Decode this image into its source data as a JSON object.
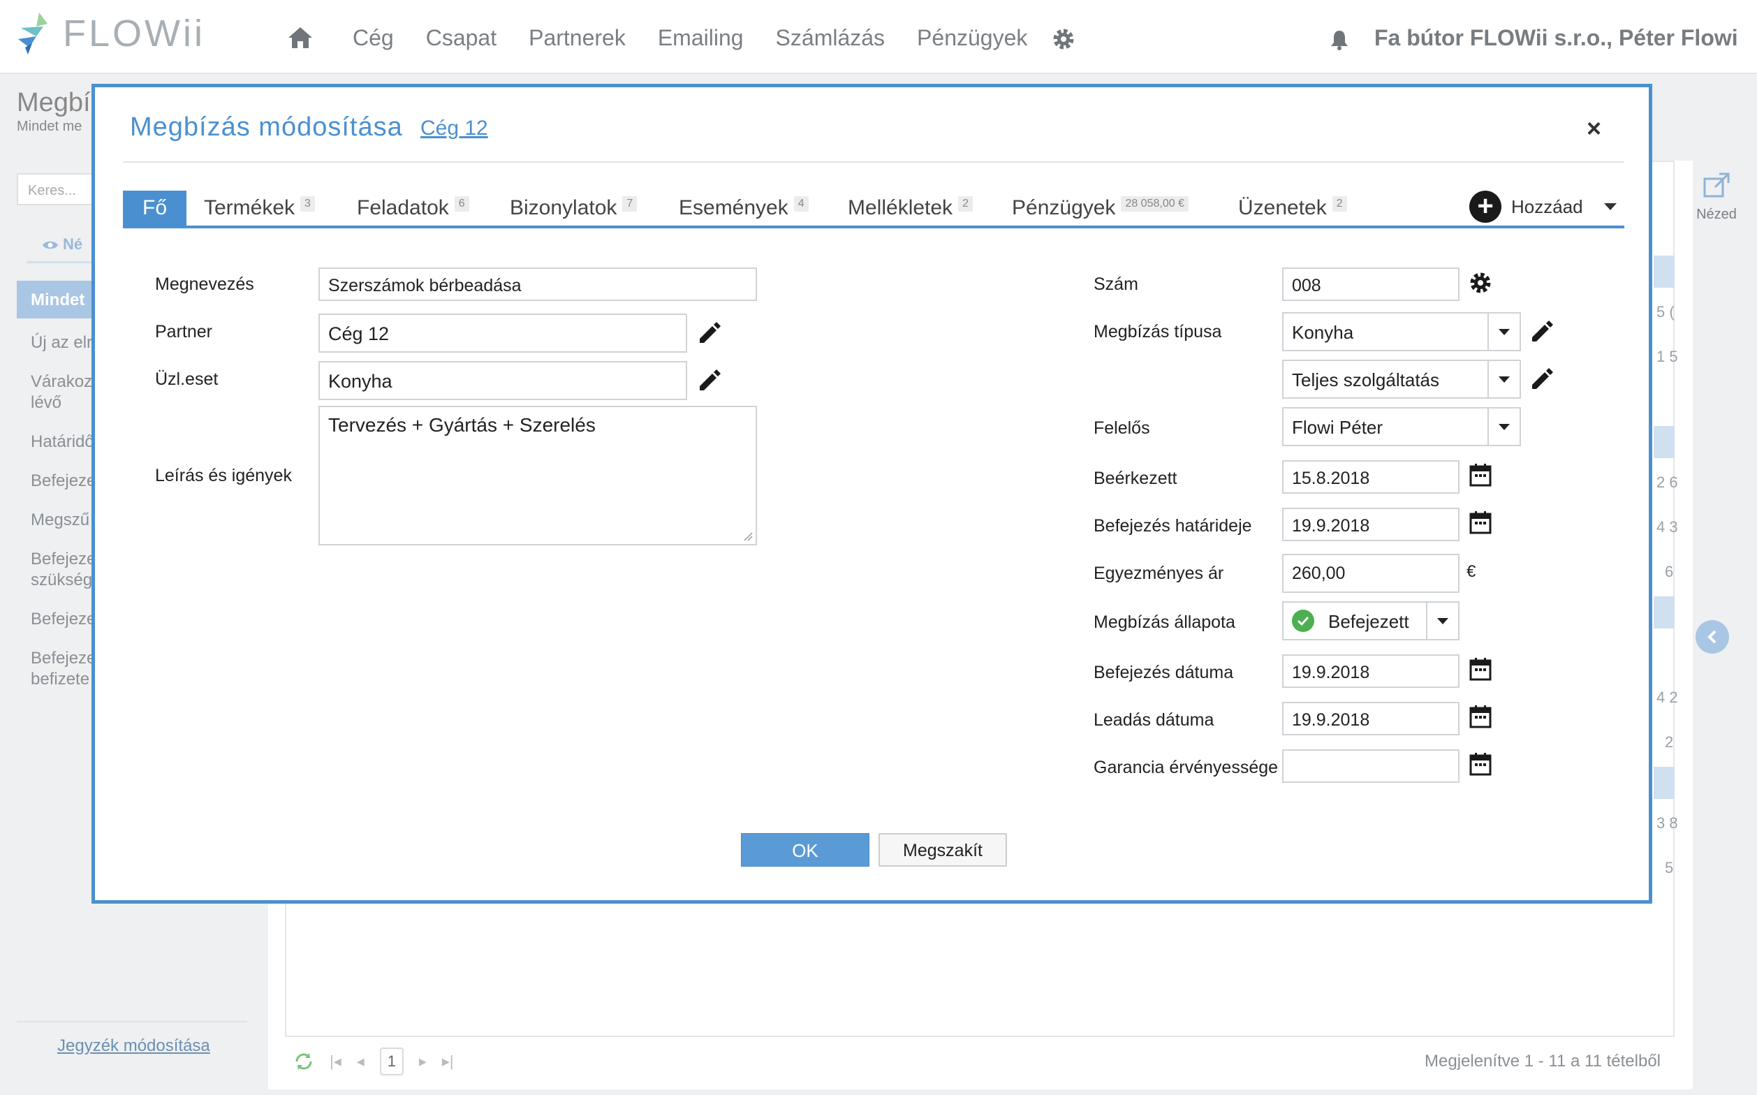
{
  "app": {
    "logo_text": "FLOWii",
    "nav": [
      "Cég",
      "Csapat",
      "Partnerek",
      "Emailing",
      "Számlázás",
      "Pénzügyek"
    ],
    "company_user": "Fa bútor FLOWii s.r.o., Péter Flowi"
  },
  "background": {
    "title": "Megbí",
    "subtitle": "Mindet me",
    "search_placeholder": "Keres...",
    "view_label": "Né",
    "active_item": "Mindet",
    "list_items": [
      "Új az elr",
      "Várakoz lévő",
      "Határidő",
      "Befejeze",
      "Megszű",
      "Befejeze szükség",
      "Befejeze",
      "Befejeze befizete"
    ],
    "footer_link": "Jegyzék módosítása",
    "export_label": "Nézed",
    "pager_page": "1",
    "count_text": "Megjelenítve 1 - 11 a 11 tételből",
    "right_numbers": [
      "5 (",
      "1 5",
      "2 6",
      "4 3",
      "6",
      "4 2",
      "2",
      "3 8",
      "5"
    ]
  },
  "modal": {
    "title": "Megbízás módosítása",
    "link": "Cég 12",
    "close": "×",
    "tabs": [
      {
        "label": "Fő",
        "badge": ""
      },
      {
        "label": "Termékek",
        "badge": "3"
      },
      {
        "label": "Feladatok",
        "badge": "6"
      },
      {
        "label": "Bizonylatok",
        "badge": "7"
      },
      {
        "label": "Események",
        "badge": "4"
      },
      {
        "label": "Mellékletek",
        "badge": "2"
      },
      {
        "label": "Pénzügyek",
        "badge": "28 058,00 €"
      },
      {
        "label": "Üzenetek",
        "badge": "2"
      }
    ],
    "add_label": "Hozzáad",
    "left": {
      "name_label": "Megnevezés",
      "name_value": "Szerszámok bérbeadása",
      "partner_label": "Partner",
      "partner_value": "Cég 12",
      "case_label": "Üzl.eset",
      "case_value": "Konyha",
      "desc_label": "Leírás és igények",
      "desc_value": "Tervezés + Gyártás + Szerelés"
    },
    "right": {
      "number_label": "Szám",
      "number_value": "008",
      "type_label": "Megbízás típusa",
      "type_value": "Konyha",
      "service_value": "Teljes szolgáltatás",
      "owner_label": "Felelős",
      "owner_value": "Flowi Péter",
      "received_label": "Beérkezett",
      "received_value": "15.8.2018",
      "deadline_label": "Befejezés határideje",
      "deadline_value": "19.9.2018",
      "price_label": "Egyezményes ár",
      "price_value": "260,00",
      "currency": "€",
      "status_label": "Megbízás állapota",
      "status_value": "Befejezett",
      "status_color": "#4caf50",
      "completed_label": "Befejezés dátuma",
      "completed_value": "19.9.2018",
      "delivery_label": "Leadás dátuma",
      "delivery_value": "19.9.2018",
      "warranty_label": "Garancia érvényessége",
      "warranty_value": ""
    },
    "ok_label": "OK",
    "cancel_label": "Megszakít"
  },
  "colors": {
    "accent": "#4a90d0",
    "ok_button": "#5b9bd5"
  }
}
